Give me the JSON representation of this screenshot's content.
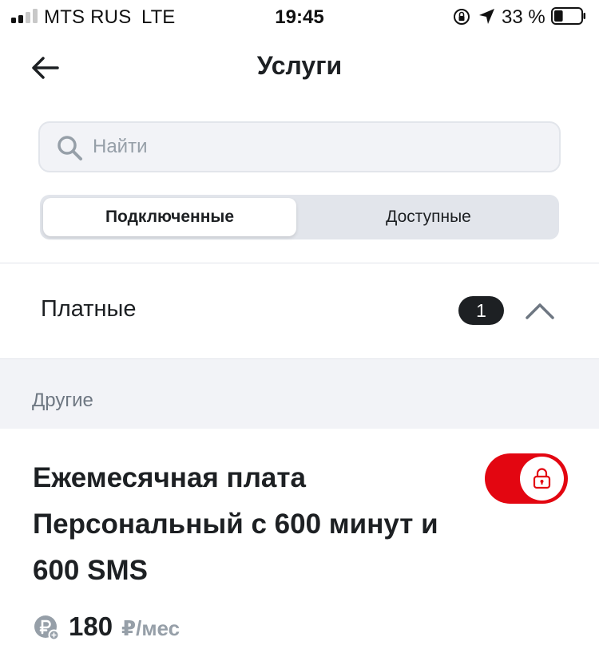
{
  "status_bar": {
    "carrier": "MTS RUS",
    "network": "LTE",
    "time": "19:45",
    "battery_percent": "33 %",
    "battery_level": 0.33,
    "signal_bars_active": 2,
    "signal_bars_total": 4
  },
  "header": {
    "title": "Услуги",
    "back_icon": "arrow-left-icon"
  },
  "search": {
    "placeholder": "Найти",
    "value": ""
  },
  "tabs": [
    {
      "label": "Подключенные",
      "selected": true
    },
    {
      "label": "Доступные",
      "selected": false
    }
  ],
  "section": {
    "title": "Платные",
    "count": "1",
    "expanded": true
  },
  "group": {
    "label": "Другие"
  },
  "service": {
    "title": "Ежемесячная плата Персональный с 600 минут и 600 SMS",
    "toggle_on": true,
    "toggle_locked": true,
    "price": "180",
    "price_unit": "₽/мес"
  },
  "colors": {
    "accent": "#e30611",
    "text": "#1d2023",
    "muted": "#969fa8",
    "surface": "#f2f3f7",
    "border": "#e2e5eb"
  }
}
